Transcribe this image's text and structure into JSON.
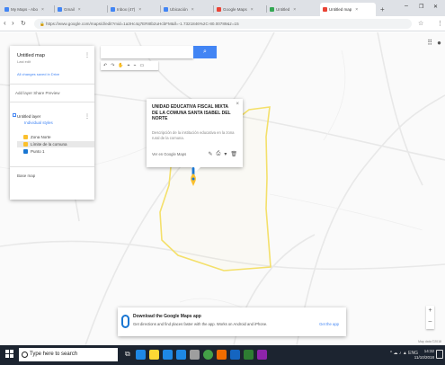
{
  "browser": {
    "tabs": [
      {
        "label": "My Maps - Abo",
        "color": "#4285f4"
      },
      {
        "label": "Gmail",
        "color": "#4285f4"
      },
      {
        "label": "Inbox (47)",
        "color": "#4285f4"
      },
      {
        "label": "Ubicación",
        "color": "#4285f4"
      },
      {
        "label": "Google Maps",
        "color": "#ea4335"
      },
      {
        "label": "Untitled",
        "color": "#34a853"
      },
      {
        "label": "Untitled map",
        "color": "#ea4335"
      }
    ],
    "url": "https://www.google.com/maps/d/edit?mid=1a3Hc4q7ER8tb2uHcbFM&ll=-1.7321846%2C-80.00789&z=15",
    "new_tab": "+",
    "window_controls": [
      "–",
      "❐",
      "✕"
    ],
    "extensions": [
      "☆",
      "⋮"
    ]
  },
  "map": {
    "search_button_icon": "search-icon",
    "tool_icons": [
      "↶",
      "↷",
      "✋",
      "⌖",
      "⌁",
      "▭"
    ],
    "topright_icons": [
      "⠿",
      "●"
    ],
    "zoom": {
      "in": "+",
      "out": "–"
    },
    "attribution": "Map data ©2018"
  },
  "panel": {
    "title": "Untitled map",
    "subtitle": "Last edit",
    "views": "All changes saved in Drive",
    "actions": "Add layer   Share   Preview",
    "layer": {
      "name": "Untitled layer",
      "link": "Individual styles",
      "features": [
        {
          "label": "Zona Norte",
          "color": "#fbc02d",
          "selected": false
        },
        {
          "label": "Límite de la comuna",
          "color": "#fbc02d",
          "selected": true
        },
        {
          "label": "Punto 1",
          "color": "#1976d2",
          "selected": false
        }
      ]
    },
    "basemap": "Base map"
  },
  "popup": {
    "title": "UNIDAD EDUCATIVA FISCAL MIXTA DE LA COMUNA SANTA ISABEL DEL NORTE",
    "description": "Descripción de la institución educativa en la zona rural de la comuna.",
    "link": "Ver en Google Maps",
    "actions": [
      "✎",
      "⎙",
      "▾",
      "🗑"
    ]
  },
  "banner": {
    "title": "Download the Google Maps app",
    "text": "Get directions and find places faster with the app. Works on Android and iPhone.",
    "link": "Get the app"
  },
  "taskbar": {
    "search_placeholder": "Type here to search",
    "apps": [
      {
        "name": "edge",
        "color": "#1e88e5"
      },
      {
        "name": "file-explorer",
        "color": "#fdd835"
      },
      {
        "name": "store",
        "color": "#1e88e5"
      },
      {
        "name": "mail",
        "color": "#1e88e5"
      },
      {
        "name": "camera",
        "color": "#9e9e9e"
      },
      {
        "name": "chrome",
        "color": "#43a047"
      },
      {
        "name": "photos",
        "color": "#ef6c00"
      },
      {
        "name": "word",
        "color": "#1565c0"
      },
      {
        "name": "sheets",
        "color": "#2e7d32"
      },
      {
        "name": "maps",
        "color": "#8e24aa"
      }
    ],
    "tray": "^  ☁  ♪  ▲  ENG",
    "time": "14:32",
    "date": "11/10/2018"
  },
  "colors": {
    "accent": "#4285f4",
    "boundary": "#f4e06a",
    "taskbar": "#1c2430"
  }
}
